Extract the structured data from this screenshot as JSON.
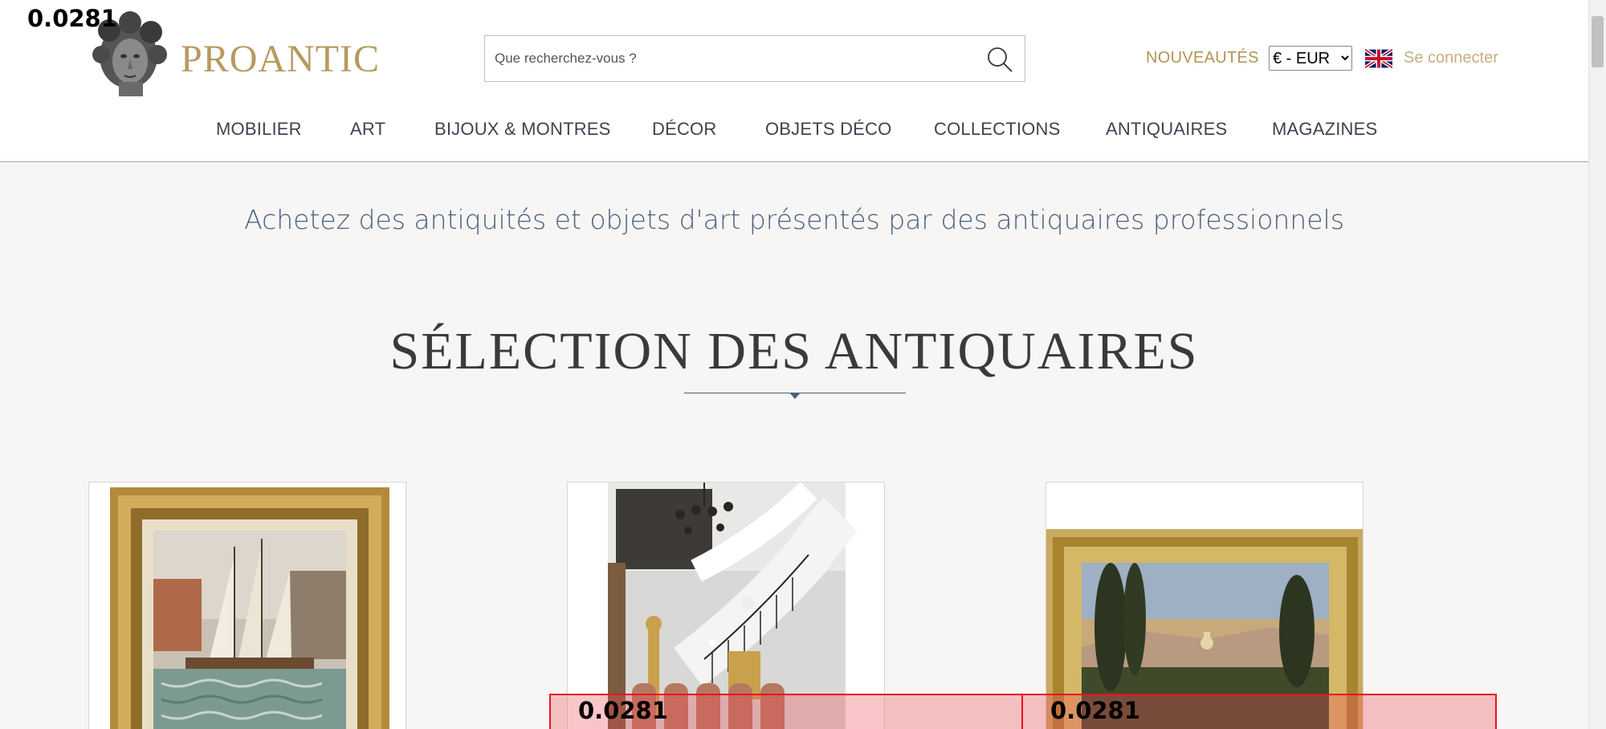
{
  "debug": {
    "top_label": "0.0281",
    "overlay_label_1": "0.0281",
    "overlay_label_2": "0.0281"
  },
  "brand": {
    "name": "PROANTIC",
    "logo_icon": "bust-sculpture-icon"
  },
  "search": {
    "placeholder": "Que recherchez-vous ?",
    "icon": "search-icon"
  },
  "header": {
    "new_label": "NOUVEAUTÉS",
    "currency_selected": "€ - EUR",
    "language_icon": "uk-flag-icon",
    "login_label": "Se connecter"
  },
  "nav": {
    "items": [
      {
        "label": "MOBILIER"
      },
      {
        "label": "ART"
      },
      {
        "label": "BIJOUX & MONTRES"
      },
      {
        "label": "DÉCOR"
      },
      {
        "label": "OBJETS DÉCO"
      },
      {
        "label": "COLLECTIONS"
      },
      {
        "label": "ANTIQUAIRES"
      },
      {
        "label": "MAGAZINES"
      }
    ]
  },
  "main": {
    "tagline": "Achetez des antiquités et objets d'art présentés par des antiquaires professionnels",
    "section_title": "SÉLECTION DES ANTIQUAIRES"
  },
  "colors": {
    "brand_gold": "#b89a5f",
    "nav_text": "#3d4450",
    "tagline_blue": "#4c617f",
    "overlay_red": "#e8141e"
  }
}
